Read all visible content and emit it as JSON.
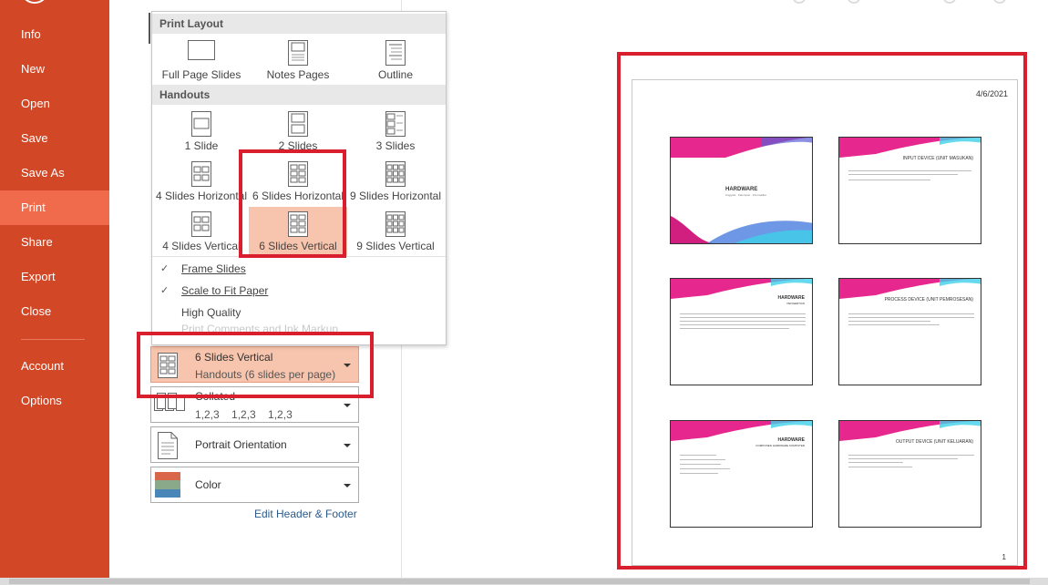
{
  "sidebar": {
    "items": [
      {
        "label": "Info"
      },
      {
        "label": "New"
      },
      {
        "label": "Open"
      },
      {
        "label": "Save"
      },
      {
        "label": "Save As"
      },
      {
        "label": "Print"
      },
      {
        "label": "Share"
      },
      {
        "label": "Export"
      },
      {
        "label": "Close"
      },
      {
        "label": "Account"
      },
      {
        "label": "Options"
      }
    ],
    "active": "Print",
    "accent_color": "#d24726",
    "active_color": "#f06b4b"
  },
  "dropdown": {
    "print_layout_header": "Print Layout",
    "layouts": [
      "Full Page Slides",
      "Notes Pages",
      "Outline"
    ],
    "handouts_header": "Handouts",
    "handouts": [
      "1 Slide",
      "2 Slides",
      "3 Slides",
      "4 Slides Horizontal",
      "6 Slides Horizontal",
      "9 Slides Horizontal",
      "4 Slides Vertical",
      "6 Slides Vertical",
      "9 Slides Vertical"
    ],
    "selected_handout": "6 Slides Vertical",
    "options": [
      {
        "label": "Frame Slides",
        "checked": true
      },
      {
        "label": "Scale to Fit Paper",
        "checked": true
      },
      {
        "label": "High Quality",
        "checked": false
      }
    ],
    "faded_option": "Print Comments and Ink Markup"
  },
  "settings": {
    "layout": {
      "title": "6 Slides Vertical",
      "subtitle": "Handouts (6 slides per page)"
    },
    "collation": {
      "title": "Collated",
      "subtitle": "1,2,3    1,2,3    1,2,3"
    },
    "orientation": {
      "title": "Portrait Orientation"
    },
    "color": {
      "title": "Color"
    },
    "edit_link": "Edit Header & Footer"
  },
  "preview": {
    "date": "4/6/2021",
    "page_number": "1",
    "slides": [
      {
        "title": "HARDWARE",
        "subtitle": "Anggota · Kelompok · Informatika"
      },
      {
        "title": "INPUT DEVICE (UNIT MASUKAN)"
      },
      {
        "title": "HARDWARE",
        "subtitle": "PENGERTIAN"
      },
      {
        "title": "PROCESS DEVICE (UNIT PEMROSESAN)"
      },
      {
        "title": "HARDWARE",
        "subtitle": "KOMPONEN HARDWARE KOMPUTER"
      },
      {
        "title": "OUTPUT DEVICE (UNIT KELUARAN)"
      }
    ]
  },
  "highlight_color": "#d91f2e"
}
